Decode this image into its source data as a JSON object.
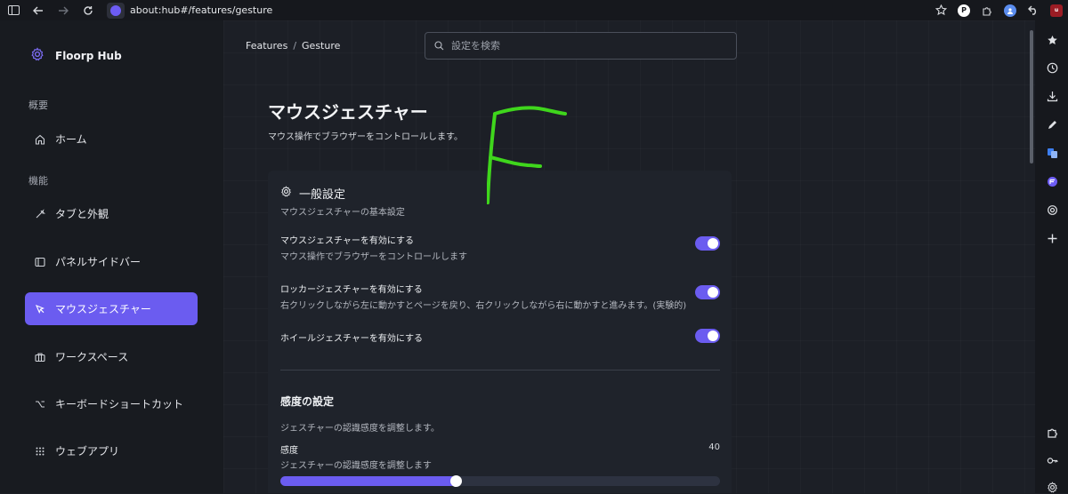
{
  "browser": {
    "url": "about:hub#/features/gesture"
  },
  "sidebar": {
    "brand": "Floorp Hub",
    "sections": [
      {
        "label": "概要"
      },
      {
        "label": "機能"
      }
    ],
    "items": [
      {
        "label": "ホーム",
        "icon": "home-icon"
      },
      {
        "label": "タブと外観",
        "icon": "wand-icon"
      },
      {
        "label": "パネルサイドバー",
        "icon": "panel-icon"
      },
      {
        "label": "マウスジェスチャー",
        "icon": "cursor-icon",
        "active": true
      },
      {
        "label": "ワークスペース",
        "icon": "briefcase-icon"
      },
      {
        "label": "キーボードショートカット",
        "icon": "option-key-icon"
      },
      {
        "label": "ウェブアプリ",
        "icon": "grid-icon"
      }
    ]
  },
  "header": {
    "breadcrumb": [
      "Features",
      "Gesture"
    ],
    "search_placeholder": "設定を検索"
  },
  "page": {
    "title": "マウスジェスチャー",
    "description": "マウス操作でブラウザーをコントロールします。"
  },
  "general": {
    "title": "一般設定",
    "subtitle": "マウスジェスチャーの基本設定",
    "settings": [
      {
        "title": "マウスジェスチャーを有効にする",
        "description": "マウス操作でブラウザーをコントロールします",
        "enabled": true
      },
      {
        "title": "ロッカージェスチャーを有効にする",
        "description": "右クリックしながら左に動かすとページを戻り、右クリックしながら右に動かすと進みます。(実験的)",
        "enabled": true
      },
      {
        "title": "ホイールジェスチャーを有効にする",
        "description": "",
        "enabled": true
      }
    ]
  },
  "sensitivity": {
    "title": "感度の設定",
    "description": "ジェスチャーの認識感度を調整します。",
    "slider_label": "感度",
    "slider_description": "ジェスチャーの認識感度を調整します",
    "value": "40",
    "fill_fraction": 0.4
  },
  "colors": {
    "accent": "#6b5cf0",
    "gesture_trail": "#3fd61c"
  }
}
